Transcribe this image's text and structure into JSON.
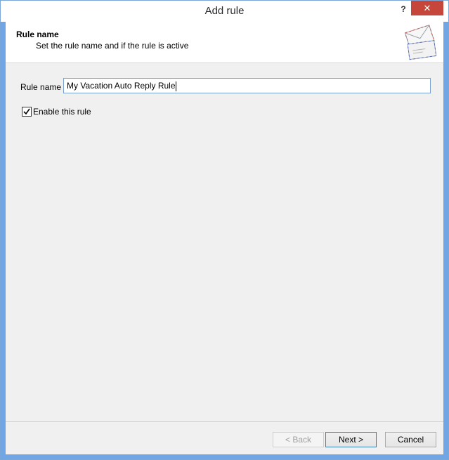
{
  "window": {
    "title": "Add rule",
    "help_glyph": "?",
    "close_glyph": "✕"
  },
  "header": {
    "title": "Rule name",
    "subtitle": "Set the rule name and if the rule is active",
    "icon": "envelopes-icon"
  },
  "form": {
    "rule_name_label": "Rule name",
    "rule_name_value": "My Vacation Auto Reply Rule",
    "enable_label": "Enable this rule",
    "enable_checked": true
  },
  "buttons": {
    "back": "< Back",
    "next": "Next >",
    "cancel": "Cancel"
  }
}
